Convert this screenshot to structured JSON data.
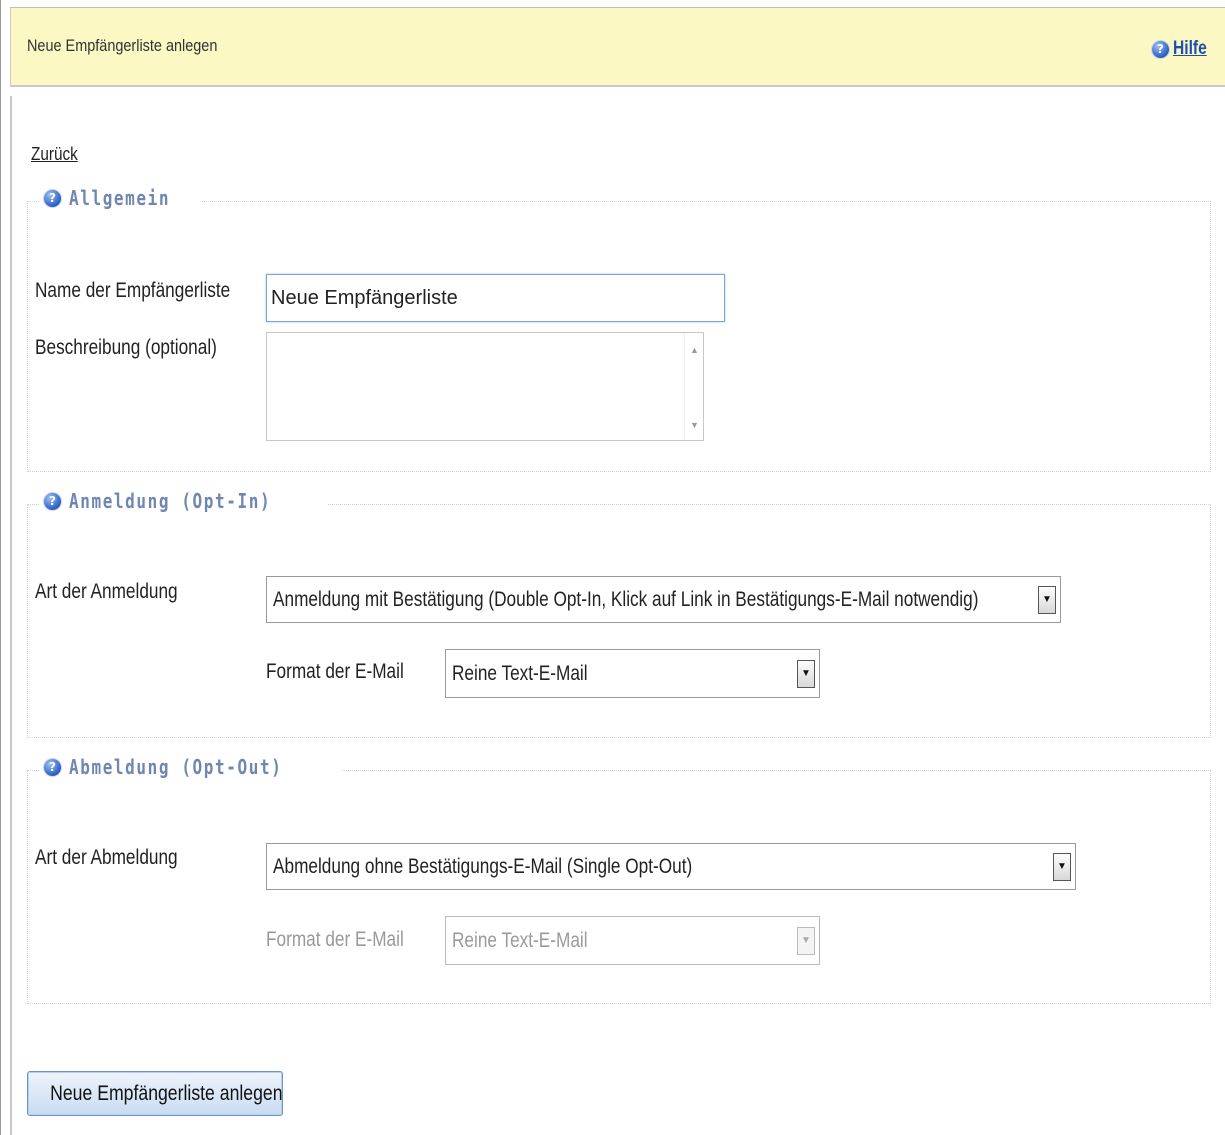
{
  "header": {
    "title": "Neue Empfängerliste anlegen",
    "help_label": "Hilfe"
  },
  "nav": {
    "back_label": "Zurück"
  },
  "sections": {
    "general": {
      "legend": "Allgemein",
      "name_label": "Name der Empfängerliste",
      "name_value": "Neue Empfängerliste",
      "description_label": "Beschreibung (optional)",
      "description_value": ""
    },
    "optin": {
      "legend": "Anmeldung (Opt-In)",
      "type_label": "Art der Anmeldung",
      "type_value": "Anmeldung mit Bestätigung (Double Opt-In, Klick auf Link in Bestätigungs-E-Mail notwendig)",
      "format_label": "Format der E-Mail",
      "format_value": "Reine Text-E-Mail"
    },
    "optout": {
      "legend": "Abmeldung (Opt-Out)",
      "type_label": "Art der Abmeldung",
      "type_value": "Abmeldung ohne Bestätigungs-E-Mail (Single Opt-Out)",
      "format_label": "Format der E-Mail",
      "format_value": "Reine Text-E-Mail"
    }
  },
  "submit_label": "Neue Empfängerliste anlegen",
  "icons": {
    "help": "help-icon",
    "dropdown": "chevron-down-icon"
  },
  "colors": {
    "header_bg": "#fbf8c4",
    "legend_text": "#6f87b0",
    "link": "#1d4fb3"
  }
}
